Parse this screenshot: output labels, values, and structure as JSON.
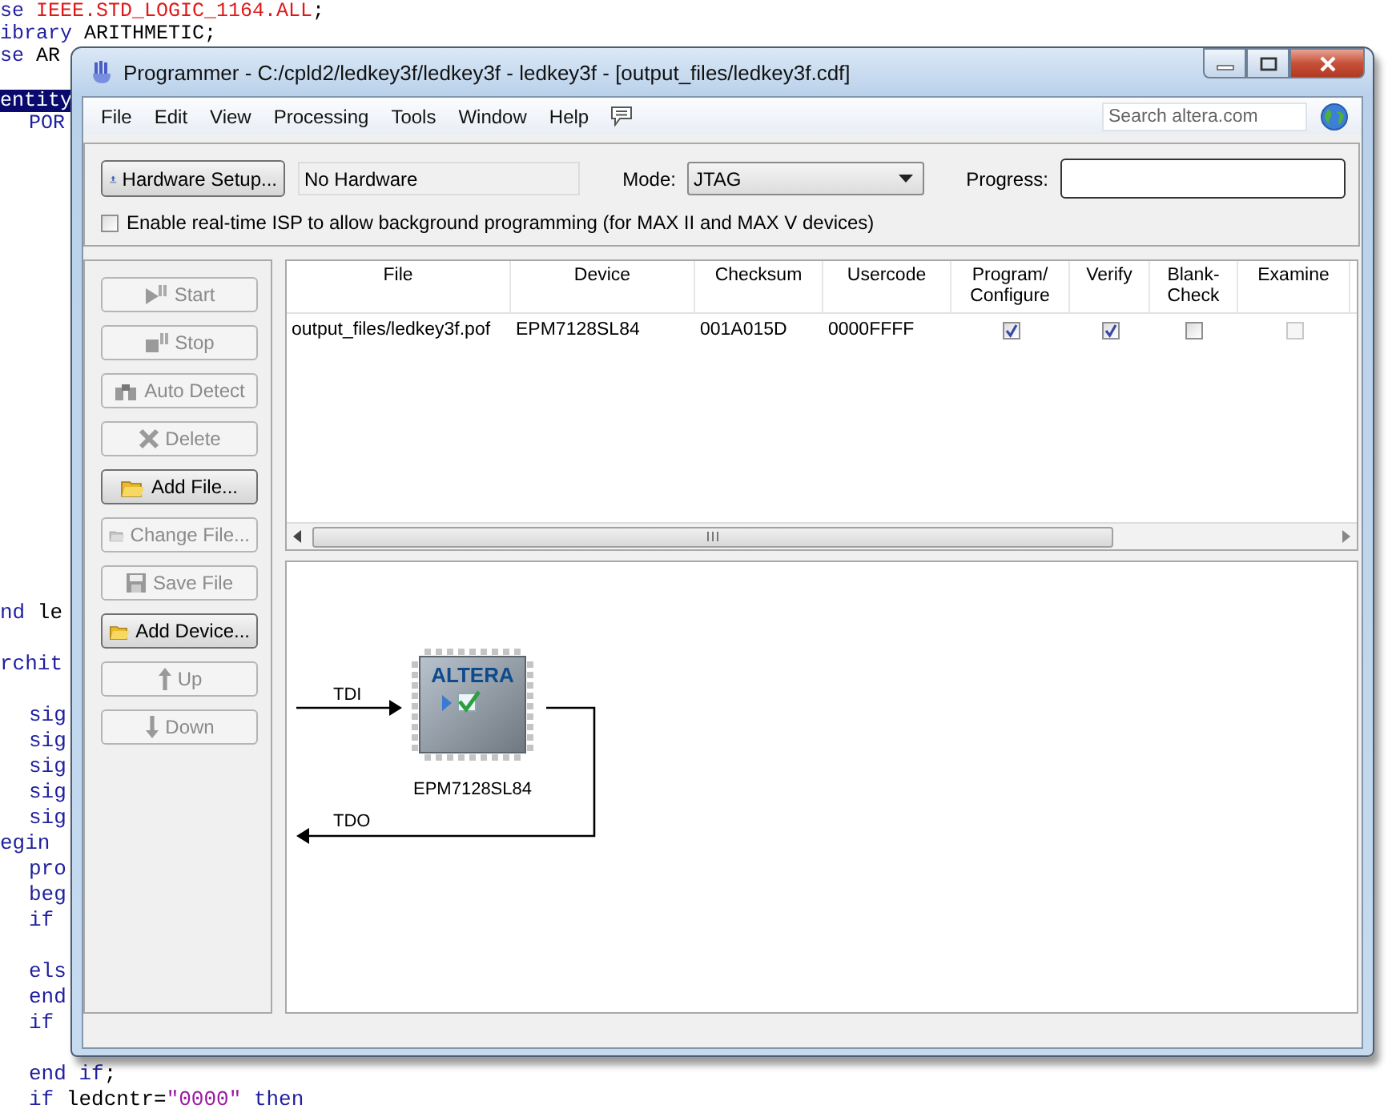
{
  "editor": {
    "top_blocks": [
      [
        {
          "highlighted": false,
          "indent": false,
          "tokens": [
            {
              "kind": "keyword",
              "text": "se"
            },
            {
              "kind": "literal",
              "text": " IEEE.STD_LOGIC_1164.ALL"
            },
            {
              "kind": "plain",
              "text": ";"
            }
          ]
        },
        {
          "highlighted": false,
          "indent": false,
          "tokens": [
            {
              "kind": "keyword",
              "text": "ibrary"
            },
            {
              "kind": "plain",
              "text": " ARITHMETIC;"
            }
          ]
        },
        {
          "highlighted": false,
          "indent": false,
          "tokens": [
            {
              "kind": "keyword",
              "text": "se"
            },
            {
              "kind": "plain",
              "text": " AR"
            }
          ]
        }
      ],
      [
        {
          "highlighted": true,
          "indent": false,
          "tokens": [
            {
              "kind": "keyword",
              "text": "entity"
            }
          ]
        },
        {
          "highlighted": false,
          "indent": true,
          "tokens": [
            {
              "kind": "keyword",
              "text": "POR"
            }
          ]
        }
      ]
    ],
    "bottom_blocks": [
      [
        {
          "highlighted": false,
          "indent": false,
          "tokens": [
            {
              "kind": "keyword",
              "text": "nd"
            },
            {
              "kind": "plain",
              "text": " le"
            }
          ]
        }
      ],
      [
        {
          "highlighted": false,
          "indent": false,
          "tokens": [
            {
              "kind": "keyword",
              "text": "rchit"
            }
          ]
        }
      ],
      [
        {
          "highlighted": false,
          "indent": true,
          "tokens": [
            {
              "kind": "keyword",
              "text": "sig"
            }
          ]
        },
        {
          "highlighted": false,
          "indent": true,
          "tokens": [
            {
              "kind": "keyword",
              "text": "sig"
            }
          ]
        },
        {
          "highlighted": false,
          "indent": true,
          "tokens": [
            {
              "kind": "keyword",
              "text": "sig"
            }
          ]
        },
        {
          "highlighted": false,
          "indent": true,
          "tokens": [
            {
              "kind": "keyword",
              "text": "sig"
            }
          ]
        },
        {
          "highlighted": false,
          "indent": true,
          "tokens": [
            {
              "kind": "keyword",
              "text": "sig"
            }
          ]
        },
        {
          "highlighted": false,
          "indent": false,
          "tokens": [
            {
              "kind": "keyword",
              "text": "egin"
            }
          ]
        },
        {
          "highlighted": false,
          "indent": true,
          "tokens": [
            {
              "kind": "keyword",
              "text": "pro"
            }
          ]
        },
        {
          "highlighted": false,
          "indent": true,
          "tokens": [
            {
              "kind": "keyword",
              "text": "beg"
            }
          ]
        },
        {
          "highlighted": false,
          "indent": true,
          "tokens": [
            {
              "kind": "keyword",
              "text": "if"
            }
          ]
        }
      ],
      [
        {
          "highlighted": false,
          "indent": true,
          "tokens": [
            {
              "kind": "keyword",
              "text": "els"
            }
          ]
        },
        {
          "highlighted": false,
          "indent": true,
          "tokens": [
            {
              "kind": "keyword",
              "text": "end"
            }
          ]
        },
        {
          "highlighted": false,
          "indent": true,
          "tokens": [
            {
              "kind": "keyword",
              "text": "if"
            }
          ]
        }
      ],
      [
        {
          "highlighted": false,
          "indent": true,
          "tokens": [
            {
              "kind": "keyword",
              "text": "end if"
            },
            {
              "kind": "plain",
              "text": ";"
            }
          ]
        },
        {
          "highlighted": false,
          "indent": true,
          "tokens": [
            {
              "kind": "keyword",
              "text": "if"
            },
            {
              "kind": "plain",
              "text": " ledcntr="
            },
            {
              "kind": "string",
              "text": "\"0000\""
            },
            {
              "kind": "keyword",
              "text": " then"
            }
          ]
        }
      ]
    ]
  },
  "window": {
    "title": "Programmer - C:/cpld2/ledkey3f/ledkey3f - ledkey3f - [output_files/ledkey3f.cdf]"
  },
  "menu": [
    "File",
    "Edit",
    "View",
    "Processing",
    "Tools",
    "Window",
    "Help"
  ],
  "search": {
    "placeholder": "Search altera.com"
  },
  "hardware": {
    "button": "Hardware Setup...",
    "value": "No Hardware",
    "mode_label": "Mode:",
    "mode": "JTAG",
    "progress_label": "Progress:",
    "level": 0
  },
  "isp_option": {
    "label": "Enable real-time ISP to allow background programming (for MAX II and MAX V devices)",
    "checked": false
  },
  "actions": [
    {
      "label": "Start",
      "disabled": true
    },
    {
      "label": "Stop",
      "disabled": true
    },
    {
      "label": "Auto Detect",
      "disabled": true
    },
    {
      "label": "Delete",
      "disabled": true
    },
    {
      "label": "Add File...",
      "disabled": false
    },
    {
      "label": "Change File...",
      "disabled": true
    },
    {
      "label": "Save File",
      "disabled": true
    },
    {
      "label": "Add Device...",
      "disabled": false
    },
    {
      "label": "Up",
      "disabled": true
    },
    {
      "label": "Down",
      "disabled": true
    }
  ],
  "table": {
    "columns": [
      "File",
      "Device",
      "Checksum",
      "Usercode",
      "Program/ Configure",
      "Verify",
      "Blank-Check",
      "Examine"
    ],
    "rows": [
      {
        "file": "output_files/ledkey3f.pof",
        "device": "EPM7128SL84",
        "checksum": "001A015D",
        "usercode": "0000FFFF",
        "checks": [
          {
            "checked": true,
            "disabled": false
          },
          {
            "checked": true,
            "disabled": false
          },
          {
            "checked": false,
            "disabled": false
          },
          {
            "checked": false,
            "disabled": true
          }
        ]
      }
    ]
  },
  "chain": {
    "tdi": "TDI",
    "tdo": "TDO",
    "devices": [
      {
        "logo": "ALTERA",
        "name": "EPM7128SL84"
      }
    ]
  }
}
